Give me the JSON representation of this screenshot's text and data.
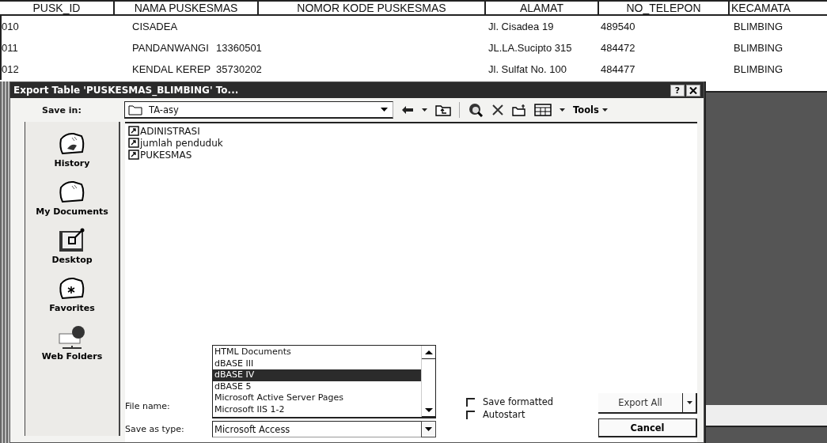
{
  "table": {
    "columns": [
      "PUSK_ID",
      "NAMA PUSKESMAS",
      "NOMOR KODE PUSKESMAS",
      "ALAMAT",
      "NO_TELEPON",
      "KECAMATA"
    ],
    "rows": [
      {
        "pusk_id": "010",
        "nama": "CISADEA",
        "alamat": "Jl. Cisadea 19",
        "telepon": "489540",
        "kecamatan": "BLIMBING"
      },
      {
        "pusk_id": "011",
        "nama": "PANDANWANGI",
        "kode": "13360501",
        "alamat": "JL.LA.Sucipto 315",
        "telepon": "484472",
        "kecamatan": "BLIMBING"
      },
      {
        "pusk_id": "012",
        "nama": "KENDAL KEREP",
        "kode": "35730202",
        "alamat": "Jl. Sulfat No. 100",
        "telepon": "484477",
        "kecamatan": "BLIMBING"
      }
    ]
  },
  "dialog": {
    "title": "Export Table 'PUSKESMAS_BLIMBING' To...",
    "help": "?",
    "save_in": {
      "label": "Save in:",
      "value": "TA-asy"
    },
    "tools": "Tools",
    "places": [
      {
        "kind": "history",
        "label": "History"
      },
      {
        "kind": "documents",
        "label": "My Documents"
      },
      {
        "kind": "desktop",
        "label": "Desktop"
      },
      {
        "kind": "favorites",
        "label": "Favorites"
      },
      {
        "kind": "web",
        "label": "Web Folders"
      }
    ],
    "files": [
      "ADINISTRASI",
      "jumlah penduduk",
      "PUKESMAS"
    ],
    "file_name_label": "File name:",
    "type_list": [
      {
        "label": "HTML Documents",
        "selected": false
      },
      {
        "label": "dBASE III",
        "selected": false
      },
      {
        "label": "dBASE IV",
        "selected": true
      },
      {
        "label": "dBASE 5",
        "selected": false
      },
      {
        "label": "Microsoft Active Server Pages",
        "selected": false
      },
      {
        "label": "Microsoft IIS 1-2",
        "selected": false
      }
    ],
    "save_as_type": {
      "label": "Save as type:",
      "value": "Microsoft Access"
    },
    "checkboxes": [
      {
        "label": "Save formatted",
        "checked": false
      },
      {
        "label": "Autostart",
        "checked": false
      }
    ],
    "export_button": "Export All",
    "cancel_button": "Cancel"
  }
}
